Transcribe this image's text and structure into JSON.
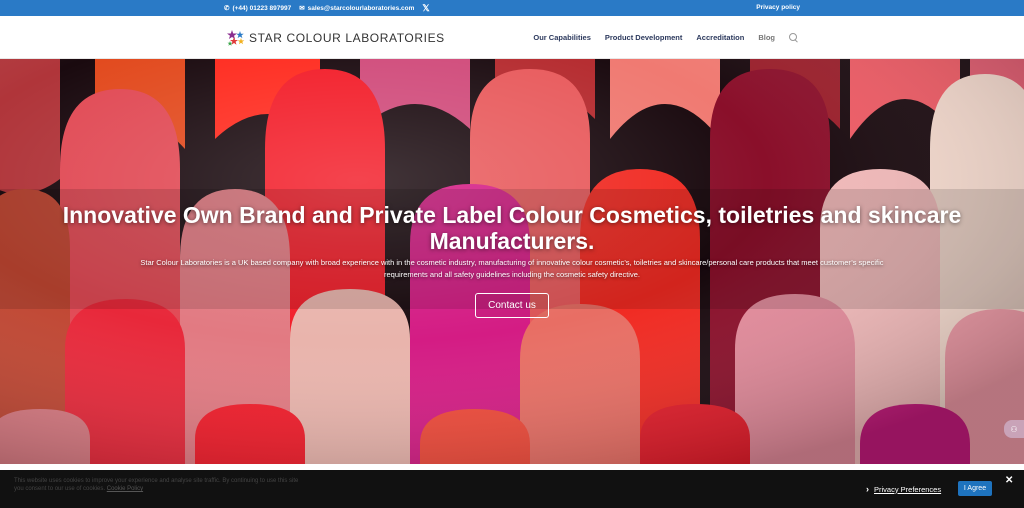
{
  "topbar": {
    "phone": "(+44) 01223 897997",
    "email": "sales@starcolourlaboratories.com",
    "social_icon": "x-icon",
    "privacy_link": "Privacy policy",
    "background": "#2a7ac6"
  },
  "header": {
    "logo_text": "STAR COLOUR LABORATORIES",
    "nav": [
      {
        "label": "Our Capabilities"
      },
      {
        "label": "Product Development"
      },
      {
        "label": "Accreditation"
      },
      {
        "label": "Blog"
      }
    ],
    "search_icon": "search-icon"
  },
  "hero": {
    "title": "Innovative Own Brand and Private Label Colour Cosmetics, toiletries and skincare Manufacturers.",
    "description": "Star Colour Laboratories is a UK based company with broad experience with in the cosmetic industry, manufacturing of innovative colour cosmetic’s, toiletries and skincare/personal care products that meet customer’s specific requirements and all safety guidelines including the cosmetic safety directive.",
    "cta_label": "Contact us"
  },
  "cookie_bar": {
    "message": "This website uses cookies to improve your experience and analyse site traffic. By continuing to use this site you consent to our use of cookies.",
    "policy_link": "Cookie Policy",
    "preferences_label": "Privacy Preferences",
    "agree_label": "I Agree",
    "close_icon": "close-icon",
    "accent": "#1e73be"
  }
}
